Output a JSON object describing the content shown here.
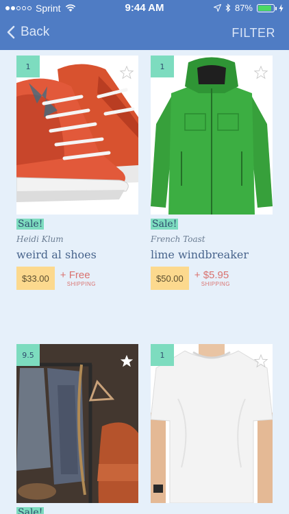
{
  "status_bar": {
    "carrier": "Sprint",
    "time": "9:44 AM",
    "battery": "87%",
    "battery_level": 0.87
  },
  "nav": {
    "back_label": "Back",
    "filter_label": "FILTER"
  },
  "products": [
    {
      "rank": "1",
      "sale_label": "Sale!",
      "brand": "Heidi Klum",
      "title": "weird al shoes",
      "price": "$33.00",
      "shipping_amount": "+ Free",
      "shipping_label": "SHIPPING",
      "favorite": false
    },
    {
      "rank": "1",
      "sale_label": "Sale!",
      "brand": "French Toast",
      "title": "lime windbreaker",
      "price": "$50.00",
      "shipping_amount": "+ $5.95",
      "shipping_label": "SHIPPING",
      "favorite": false
    },
    {
      "rank": "9.5",
      "sale_label": "Sale!",
      "favorite": true
    },
    {
      "rank": "1",
      "favorite": false
    }
  ],
  "colors": {
    "header": "#4f7cc4",
    "background": "#e6f0fa",
    "rank_badge": "#7ddcbf",
    "price_badge": "#fcd98e",
    "shipping_text": "#d9726f"
  }
}
